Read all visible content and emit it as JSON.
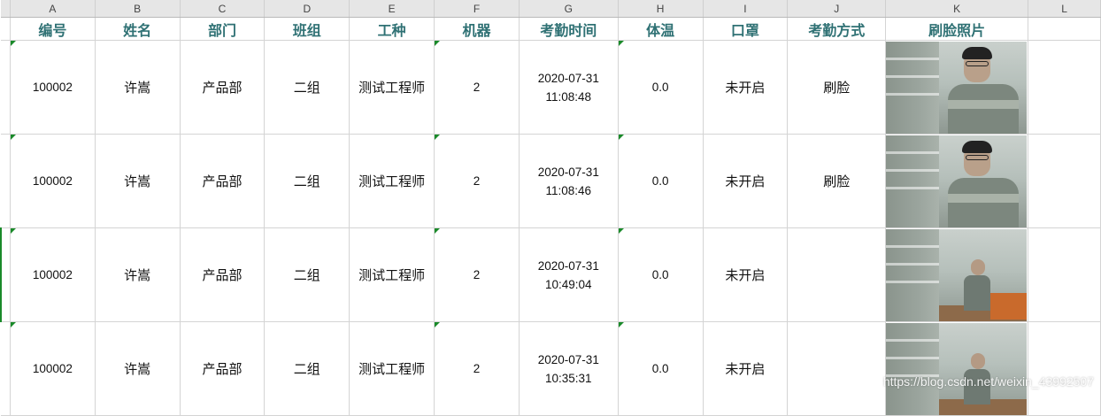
{
  "columns": [
    "A",
    "B",
    "C",
    "D",
    "E",
    "F",
    "G",
    "H",
    "I",
    "J",
    "K",
    "L"
  ],
  "headers": [
    "编号",
    "姓名",
    "部门",
    "班组",
    "工种",
    "机器",
    "考勤时间",
    "体温",
    "口罩",
    "考勤方式",
    "刷脸照片",
    ""
  ],
  "rows": [
    {
      "id": "100002",
      "name": "许嵩",
      "dept": "产品部",
      "group": "二组",
      "job": "测试工程师",
      "machine": "2",
      "date": "2020-07-31",
      "time": "11:08:48",
      "temp": "0.0",
      "mask": "未开启",
      "method": "刷脸"
    },
    {
      "id": "100002",
      "name": "许嵩",
      "dept": "产品部",
      "group": "二组",
      "job": "测试工程师",
      "machine": "2",
      "date": "2020-07-31",
      "time": "11:08:46",
      "temp": "0.0",
      "mask": "未开启",
      "method": "刷脸"
    },
    {
      "id": "100002",
      "name": "许嵩",
      "dept": "产品部",
      "group": "二组",
      "job": "测试工程师",
      "machine": "2",
      "date": "2020-07-31",
      "time": "10:49:04",
      "temp": "0.0",
      "mask": "未开启",
      "method": ""
    },
    {
      "id": "100002",
      "name": "许嵩",
      "dept": "产品部",
      "group": "二组",
      "job": "测试工程师",
      "machine": "2",
      "date": "2020-07-31",
      "time": "10:35:31",
      "temp": "0.0",
      "mask": "未开启",
      "method": ""
    }
  ],
  "watermark": "https://blog.csdn.net/weixin_43992507",
  "colors": {
    "header_text": "#2f7174",
    "error_triangle": "#1a8a2a",
    "column_header_bg": "#e6e6e6",
    "grid": "#d4d4d4"
  }
}
